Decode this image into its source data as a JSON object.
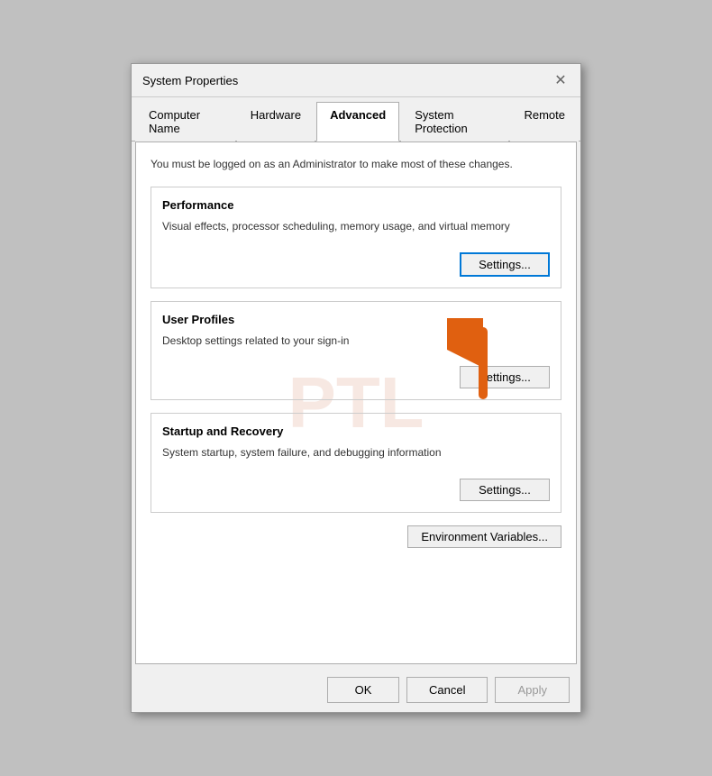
{
  "window": {
    "title": "System Properties",
    "close_label": "✕"
  },
  "tabs": [
    {
      "id": "computer-name",
      "label": "Computer Name",
      "active": false
    },
    {
      "id": "hardware",
      "label": "Hardware",
      "active": false
    },
    {
      "id": "advanced",
      "label": "Advanced",
      "active": true
    },
    {
      "id": "system-protection",
      "label": "System Protection",
      "active": false
    },
    {
      "id": "remote",
      "label": "Remote",
      "active": false
    }
  ],
  "content": {
    "admin_notice": "You must be logged on as an Administrator to make most of these changes.",
    "performance": {
      "title": "Performance",
      "description": "Visual effects, processor scheduling, memory usage, and virtual memory",
      "settings_label": "Settings..."
    },
    "user_profiles": {
      "title": "User Profiles",
      "description": "Desktop settings related to your sign-in",
      "settings_label": "Settings..."
    },
    "startup_recovery": {
      "title": "Startup and Recovery",
      "description": "System startup, system failure, and debugging information",
      "settings_label": "Settings..."
    },
    "env_variables_label": "Environment Variables..."
  },
  "footer": {
    "ok_label": "OK",
    "cancel_label": "Cancel",
    "apply_label": "Apply"
  }
}
